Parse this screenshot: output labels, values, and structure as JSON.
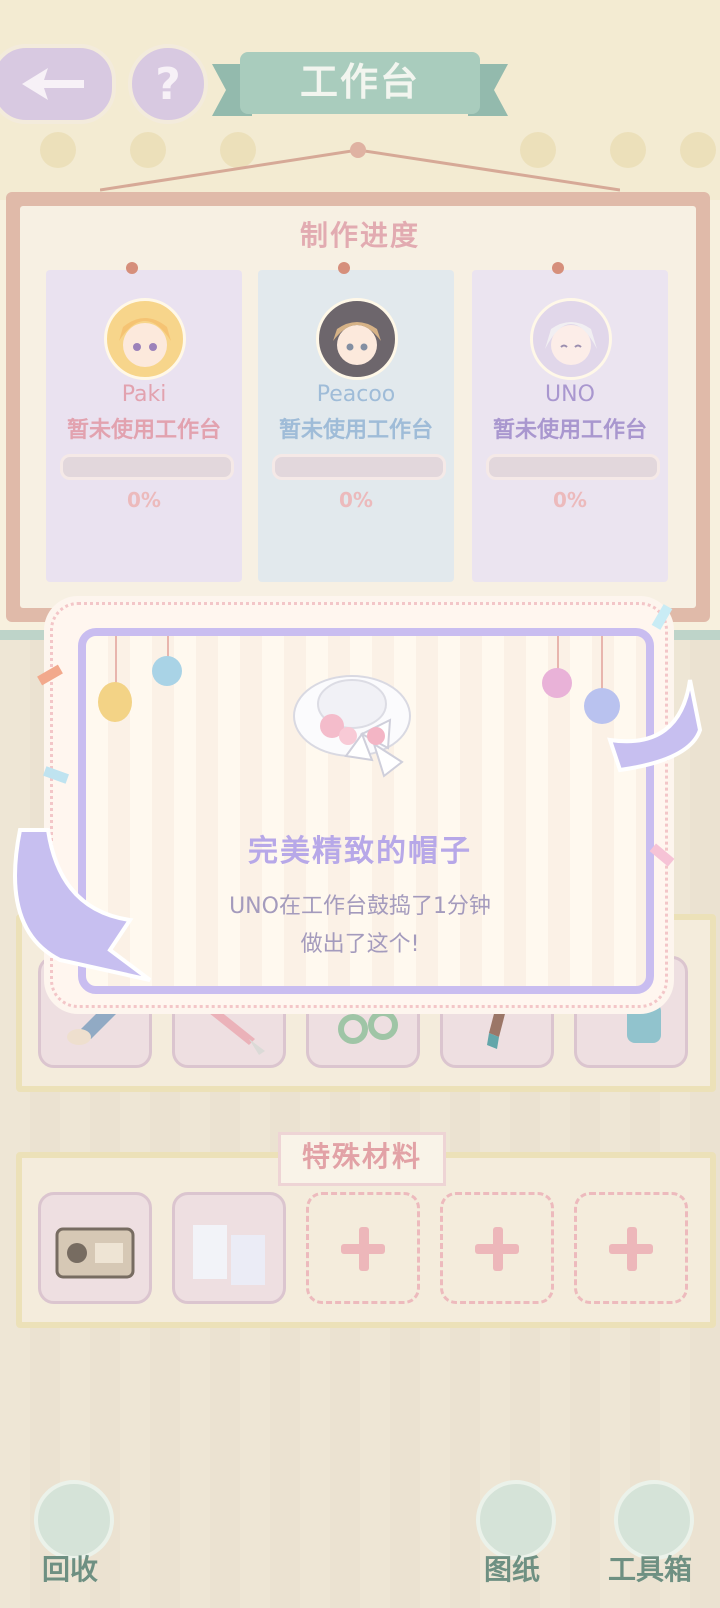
{
  "header": {
    "title": "工作台",
    "help_label": "?"
  },
  "progress_board": {
    "title": "制作进度",
    "cards": [
      {
        "name": "Paki",
        "status": "暂未使用工作台",
        "progress_text": "0%",
        "progress": 0,
        "color": "#d9849a",
        "card_color": "#e3daf0"
      },
      {
        "name": "Peacoo",
        "status": "暂未使用工作台",
        "progress_text": "0%",
        "progress": 0,
        "color": "#7fa7d0",
        "card_color": "#d8e3ec"
      },
      {
        "name": "UNO",
        "status": "暂未使用工作台",
        "progress_text": "0%",
        "progress": 0,
        "color": "#8d76c4",
        "card_color": "#e4dcf1"
      }
    ]
  },
  "popup": {
    "item_name": "完美精致的帽子",
    "desc_line1": "UNO在工作台鼓捣了1分钟",
    "desc_line2": "做出了这个!"
  },
  "special_materials": {
    "title": "特殊材料"
  },
  "bottom_nav": {
    "recycle_label": "回收",
    "blueprint_label": "图纸",
    "toolbox_label": "工具箱"
  }
}
